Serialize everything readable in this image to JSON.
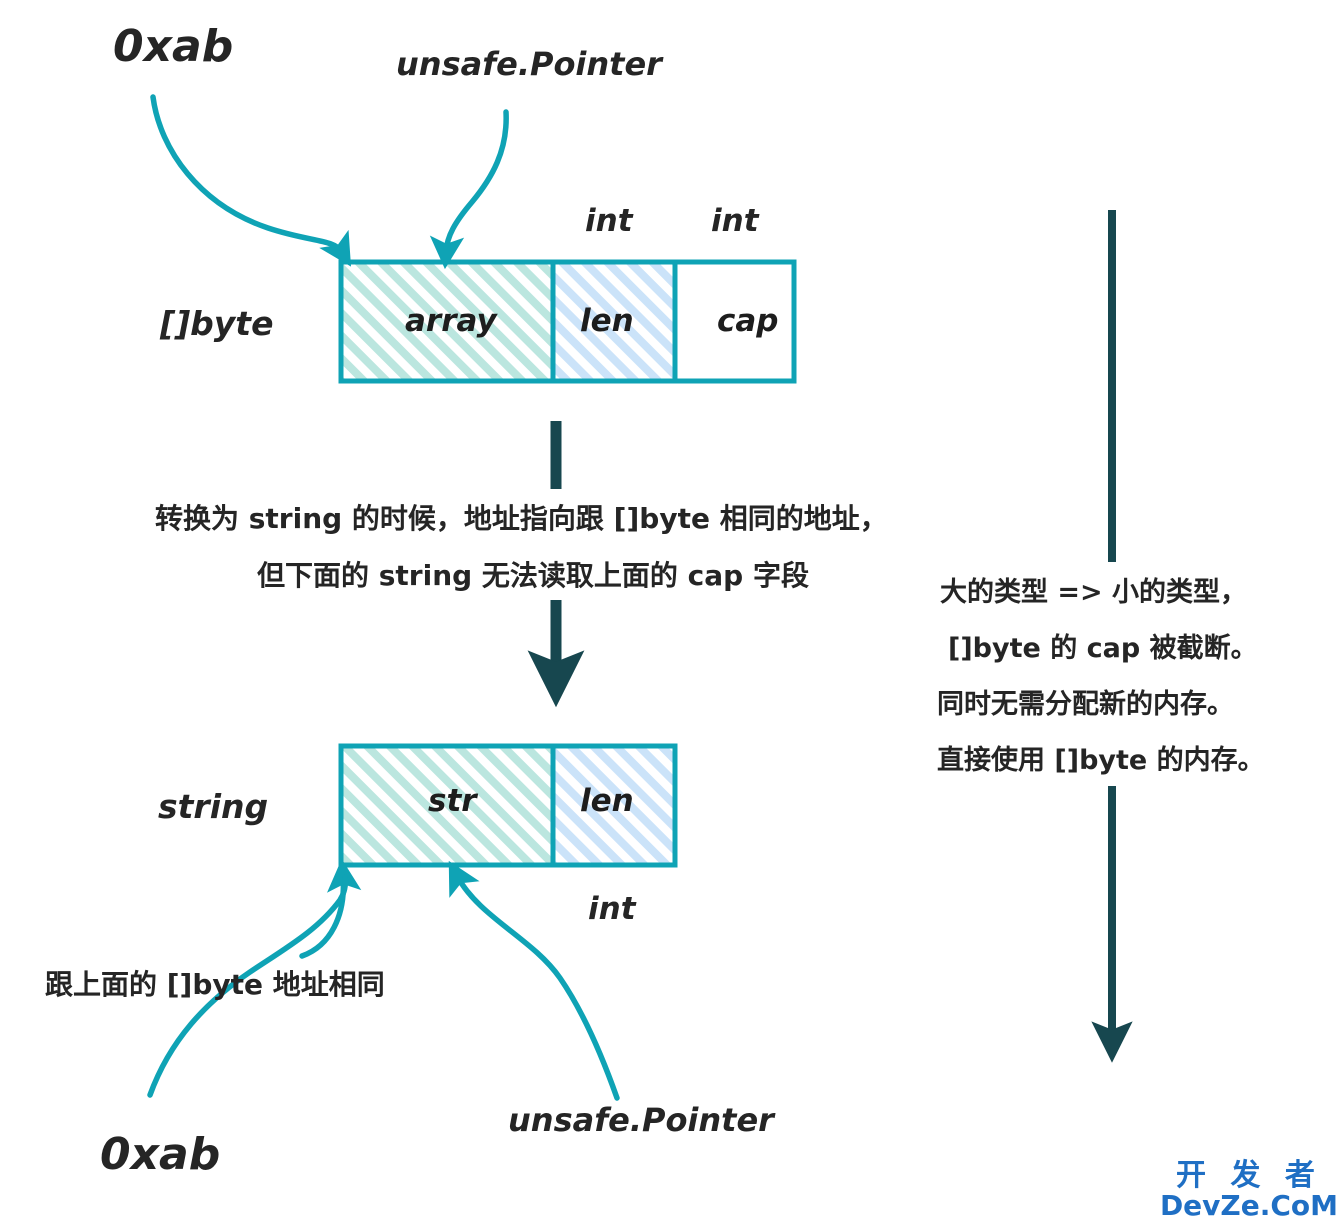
{
  "diagram": {
    "title": "Go []byte to string conversion memory layout",
    "colors": {
      "outline_teal": "#0fa3b5",
      "arrow_teal": "#0fa3b5",
      "dark_arrow": "#17474f",
      "hatch_green": "#bbe6df",
      "hatch_blue": "#cbe3f9",
      "text_dark": "#252525",
      "watermark_blue": "#1f6fc4"
    },
    "top_struct": {
      "type_label": "[]byte",
      "pointer_value": "0xab",
      "pointer_type": "unsafe.Pointer",
      "cells": [
        {
          "name": "array",
          "fill": "hatch-green",
          "type_label": ""
        },
        {
          "name": "len",
          "fill": "hatch-blue",
          "type_label": "int"
        },
        {
          "name": "cap",
          "fill": "none",
          "type_label": "int"
        }
      ]
    },
    "bottom_struct": {
      "type_label": "string",
      "pointer_value": "0xab",
      "pointer_type": "unsafe.Pointer",
      "same_address_note": "跟上面的 []byte 地址相同",
      "cells": [
        {
          "name": "str",
          "fill": "hatch-green",
          "type_label": ""
        },
        {
          "name": "len",
          "fill": "hatch-blue",
          "type_label": "int"
        }
      ]
    },
    "middle_note": {
      "line1": "转换为 string 的时候，地址指向跟 []byte 相同的地址，",
      "line2": "但下面的 string 无法读取上面的 cap 字段"
    },
    "side_note": {
      "line1": "大的类型 => 小的类型，",
      "line2": "[]byte 的 cap 被截断。",
      "line3": "同时无需分配新的内存。",
      "line4": "直接使用 []byte 的内存。"
    },
    "watermark": {
      "line1": "开 发 者",
      "line2": "DevZe.CoM"
    }
  },
  "chart_data": {
    "type": "diagram",
    "title": "Go []byte → string memory layout conversion",
    "nodes": [
      {
        "id": "bytes-header",
        "label": "[]byte",
        "fields": [
          "array",
          "len",
          "cap"
        ],
        "field_types": [
          "unsafe.Pointer",
          "int",
          "int"
        ],
        "address": "0xab"
      },
      {
        "id": "string-header",
        "label": "string",
        "fields": [
          "str",
          "len"
        ],
        "field_types": [
          "unsafe.Pointer",
          "int"
        ],
        "address": "0xab"
      }
    ],
    "edges": [
      {
        "from": "bytes-header",
        "to": "string-header",
        "label": "转换为 string 的时候，地址指向跟 []byte 相同的地址，但下面的 string 无法读取上面的 cap 字段"
      },
      {
        "from": "bytes-header",
        "to": "string-header",
        "label": "大的类型 => 小的类型，[]byte 的 cap 被截断。同时无需分配新的内存。直接使用 []byte 的内存。"
      }
    ]
  }
}
